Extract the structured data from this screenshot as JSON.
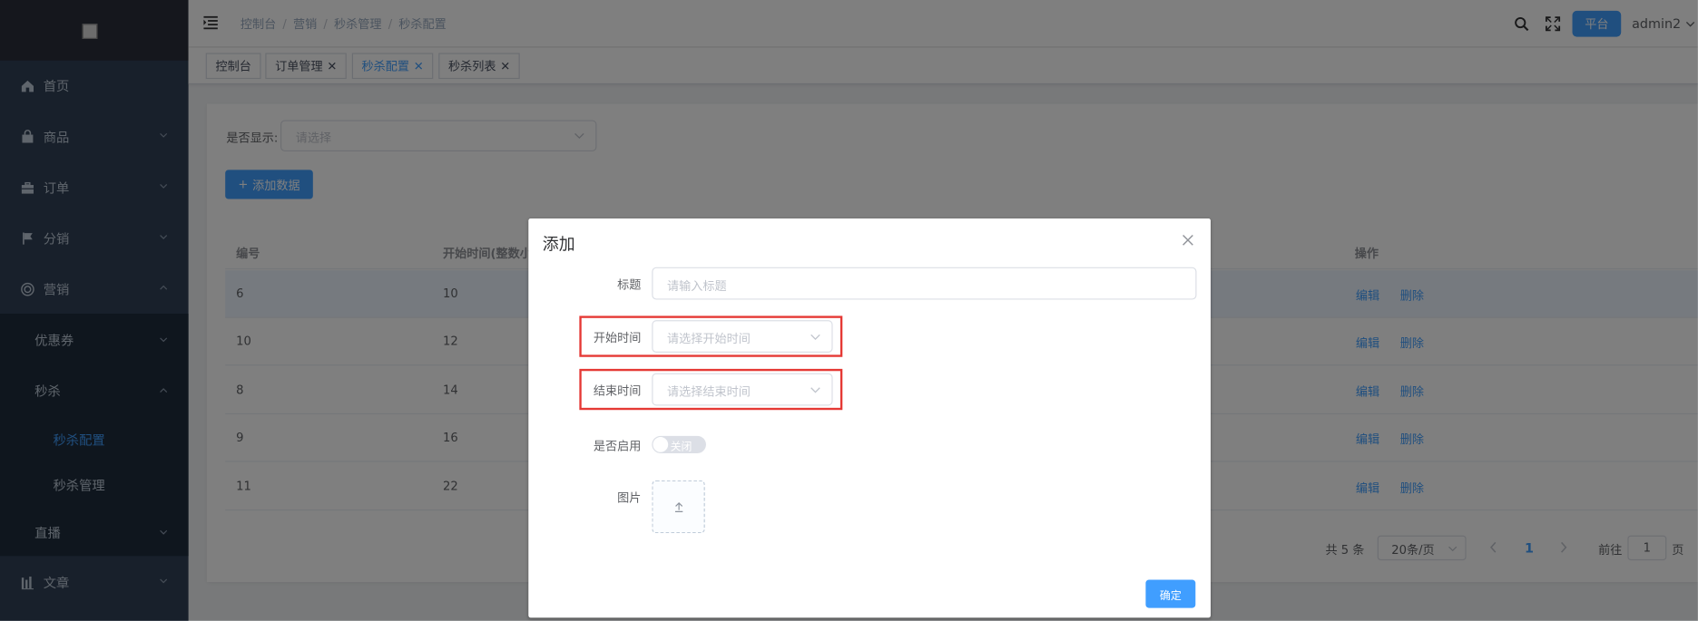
{
  "sidebar": {
    "menu": [
      {
        "label": "首页",
        "icon": "home-icon"
      },
      {
        "label": "商品",
        "icon": "bag-icon"
      },
      {
        "label": "订单",
        "icon": "briefcase-icon"
      },
      {
        "label": "分销",
        "icon": "flag-icon"
      },
      {
        "label": "营销",
        "icon": "target-icon"
      }
    ],
    "submenu": [
      {
        "label": "优惠券"
      },
      {
        "label": "秒杀"
      },
      {
        "label": "秒杀配置"
      },
      {
        "label": "秒杀管理"
      },
      {
        "label": "直播"
      }
    ],
    "bottom": {
      "label": "文章",
      "icon": "chart-icon"
    }
  },
  "navbar": {
    "breadcrumb": [
      "控制台",
      "营销",
      "秒杀管理",
      "秒杀配置"
    ],
    "platform_label": "平台",
    "user": "admin2"
  },
  "tags": [
    {
      "label": "控制台",
      "closable": false
    },
    {
      "label": "订单管理",
      "closable": true
    },
    {
      "label": "秒杀配置",
      "closable": true,
      "active": true
    },
    {
      "label": "秒杀列表",
      "closable": true
    }
  ],
  "filter": {
    "label": "是否显示:",
    "placeholder": "请选择"
  },
  "add_button": "添加数据",
  "table": {
    "headers": [
      "编号",
      "开始时间(整数小时",
      "操作"
    ],
    "rows": [
      {
        "id": "6",
        "start": "10"
      },
      {
        "id": "10",
        "start": "12"
      },
      {
        "id": "8",
        "start": "14"
      },
      {
        "id": "9",
        "start": "16"
      },
      {
        "id": "11",
        "start": "22"
      }
    ],
    "edit_label": "编辑",
    "delete_label": "删除"
  },
  "pagination": {
    "total": "共 5 条",
    "page_size": "20条/页",
    "current": "1",
    "goto_label": "前往",
    "goto_value": "1",
    "page_suffix": "页"
  },
  "dialog": {
    "title": "添加",
    "fields": {
      "title_label": "标题",
      "title_placeholder": "请输入标题",
      "start_label": "开始时间",
      "start_placeholder": "请选择开始时间",
      "end_label": "结束时间",
      "end_placeholder": "请选择结束时间",
      "enable_label": "是否启用",
      "enable_off_text": "关闭",
      "image_label": "图片"
    },
    "confirm": "确定"
  },
  "colors": {
    "primary": "#409eff",
    "sidebar": "#304156",
    "highlight_box": "#e53935"
  }
}
